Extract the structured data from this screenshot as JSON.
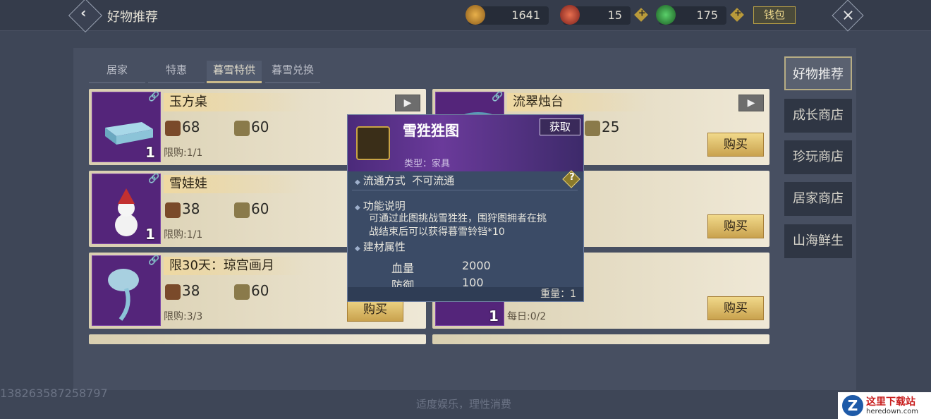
{
  "header": {
    "title": "好物推荐",
    "wallet_label": "钱包",
    "currencies": [
      {
        "name": "gold-coin",
        "value": "1641",
        "color": "#c9882a"
      },
      {
        "name": "red-coin",
        "value": "15",
        "color": "#c0442a"
      },
      {
        "name": "green-coin",
        "value": "175",
        "color": "#2f8a3a"
      }
    ]
  },
  "tabs": [
    "居家",
    "特惠",
    "暮雪特供",
    "暮雪兑换"
  ],
  "active_tab": "暮雪特供",
  "items": [
    {
      "name": "玉方桌",
      "price_a": "68",
      "price_b": "60",
      "limit": "限购:1/1",
      "qty": "1",
      "buy": ""
    },
    {
      "name": "流翠烛台",
      "price_a": "",
      "price_b": "25",
      "limit": "",
      "qty": "",
      "buy": "购买"
    },
    {
      "name": "雪娃娃",
      "price_a": "38",
      "price_b": "60",
      "limit": "限购:1/1",
      "qty": "1",
      "buy": ""
    },
    {
      "name": "",
      "price_a": "",
      "price_b": "",
      "limit": "",
      "qty": "",
      "buy": "购买"
    },
    {
      "name": "限30天：琼宫画月",
      "price_a": "38",
      "price_b": "60",
      "limit": "限购:3/3",
      "qty": "",
      "buy": "购买"
    },
    {
      "name": "",
      "price_a": "",
      "price_b": "",
      "limit": "每日:0/2",
      "qty": "1",
      "buy": "购买"
    }
  ],
  "sidebar": [
    "好物推荐",
    "成长商店",
    "珍玩商店",
    "居家商店",
    "山海鲜生"
  ],
  "popup": {
    "name": "雪狌狌图",
    "get_label": "获取",
    "type": "类型：家具",
    "circulation_label": "流通方式",
    "circulation_value": "不可流通",
    "func_title": "功能说明",
    "func_desc_1": "可通过此图挑战雪狌狌，围狩图拥者在挑",
    "func_desc_2": "战结束后可以获得暮雪铃铛*10",
    "attr_title": "建材属性",
    "hp_label": "血量",
    "hp_value": "2000",
    "def_label": "防御",
    "def_value": "100",
    "weight": "重量：1"
  },
  "footer": "适度娱乐，理性消费",
  "uid": "138263587258797",
  "logo": {
    "main": "这里下载站",
    "sub": "heredown.com"
  }
}
